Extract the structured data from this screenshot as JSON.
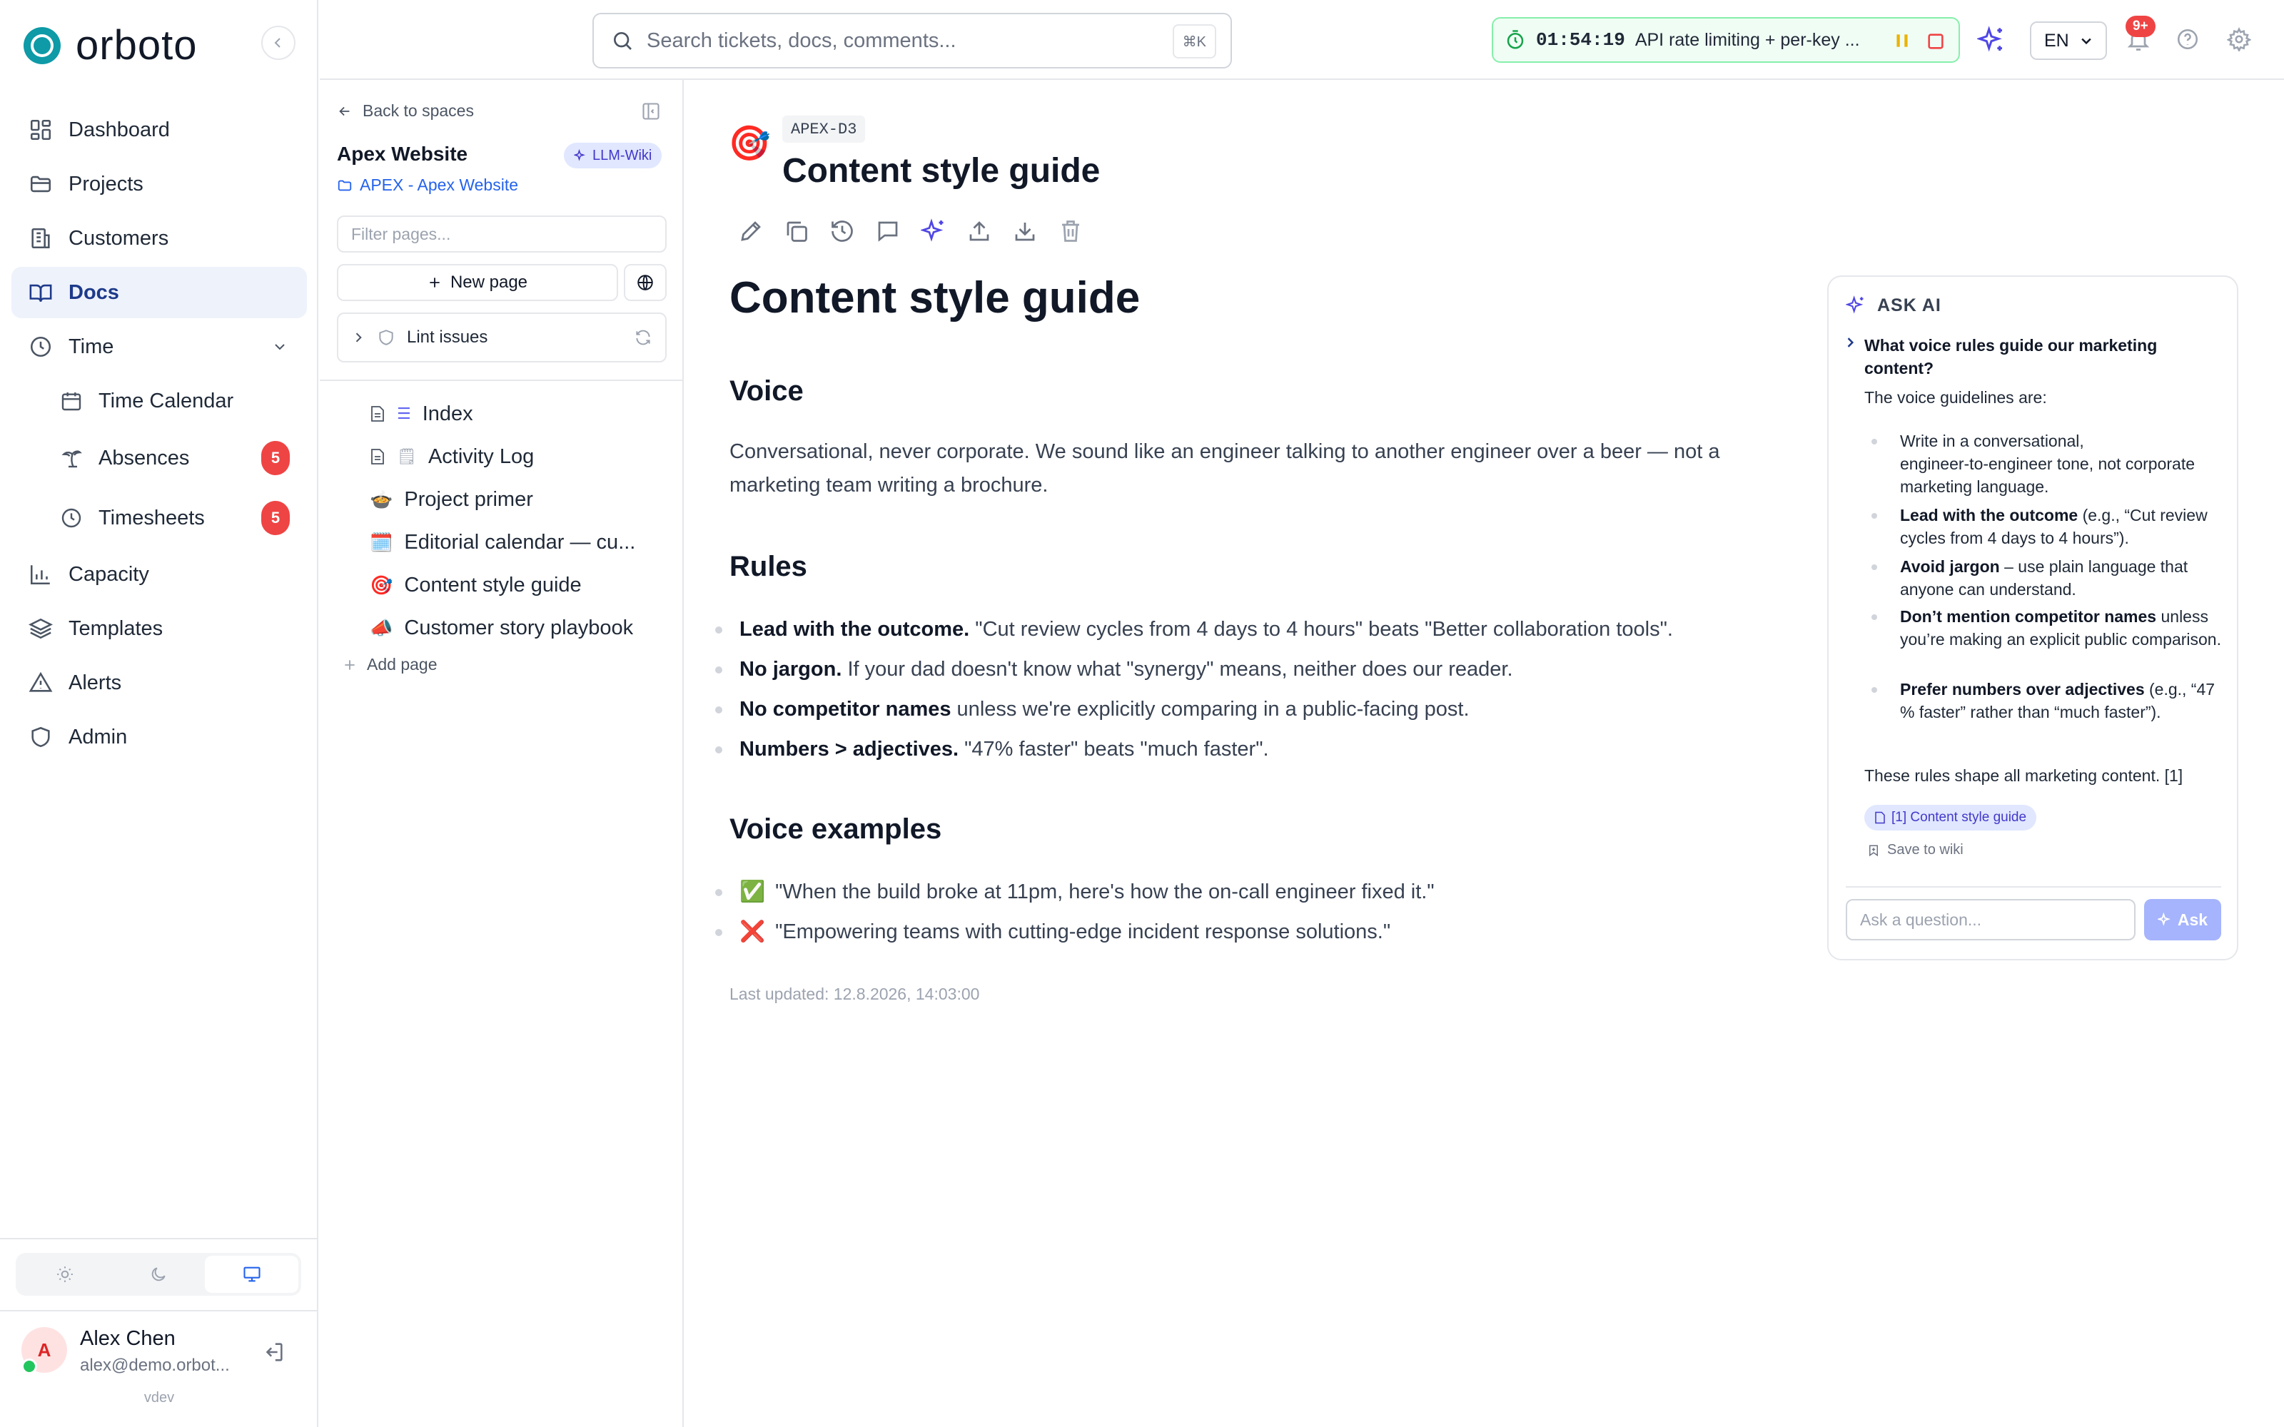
{
  "brand": {
    "name": "orboto",
    "accent": "#0e9aa7"
  },
  "nav": {
    "items": [
      {
        "label": "Dashboard",
        "icon": "dashboard-icon"
      },
      {
        "label": "Projects",
        "icon": "folder-icon"
      },
      {
        "label": "Customers",
        "icon": "building-icon"
      },
      {
        "label": "Docs",
        "icon": "book-icon"
      },
      {
        "label": "Time",
        "icon": "clock-icon"
      },
      {
        "label": "Capacity",
        "icon": "bar-chart-icon"
      },
      {
        "label": "Templates",
        "icon": "layers-icon"
      },
      {
        "label": "Alerts",
        "icon": "alert-icon"
      },
      {
        "label": "Admin",
        "icon": "shield-icon"
      }
    ],
    "time_sub": [
      {
        "label": "Time Calendar",
        "icon": "calendar-icon",
        "badge": ""
      },
      {
        "label": "Absences",
        "icon": "palm-tree-icon",
        "badge": "5"
      },
      {
        "label": "Timesheets",
        "icon": "clock-icon",
        "badge": "5"
      }
    ],
    "user": {
      "initial": "A",
      "name": "Alex Chen",
      "email": "alex@demo.orbot...",
      "version": "vdev"
    }
  },
  "tree": {
    "back_label": "Back to spaces",
    "space_name": "Apex Website",
    "space_badge": "LLM-Wiki",
    "project_link": "APEX - Apex Website",
    "filter_placeholder": "Filter pages...",
    "new_page_label": "New page",
    "lint_label": "Lint issues",
    "pages": [
      {
        "label": "Index",
        "emoji": "☰"
      },
      {
        "label": "Activity Log",
        "emoji": "🗒"
      },
      {
        "label": "Project primer",
        "emoji": "🍲"
      },
      {
        "label": "Editorial calendar — cu...",
        "emoji": "🗓️"
      },
      {
        "label": "Content style guide",
        "emoji": "🎯"
      },
      {
        "label": "Customer story playbook",
        "emoji": "📣"
      }
    ],
    "add_page_label": "Add page"
  },
  "topbar": {
    "search_placeholder": "Search tickets, docs, comments...",
    "search_shortcut": "⌘K",
    "timer_time": "01:54:19",
    "timer_task": "API rate limiting + per-key ...",
    "language": "EN",
    "notif_badge": "9+"
  },
  "doc": {
    "key": "APEX-D3",
    "emoji": "🎯",
    "title": "Content style guide",
    "heading": "Content style guide",
    "voice_h": "Voice",
    "voice_p": "Conversational, never corporate. We sound like an engineer talking to another engineer over a beer — not a marketing team writing a brochure.",
    "rules_h": "Rules",
    "rules": [
      {
        "bold": "Lead with the outcome.",
        "text": " \"Cut review cycles from 4 days to 4 hours\" beats \"Better collaboration tools\"."
      },
      {
        "bold": "No jargon.",
        "text": " If your dad doesn't know what \"synergy\" means, neither does our reader."
      },
      {
        "bold": "No competitor names",
        "text": " unless we're explicitly comparing in a public-facing post."
      },
      {
        "bold": "Numbers > adjectives.",
        "text": " \"47% faster\" beats \"much faster\"."
      }
    ],
    "examples_h": "Voice examples",
    "examples": [
      {
        "emoji": "✅",
        "text": "\"When the build broke at 11pm, here's how the on-call engineer fixed it.\""
      },
      {
        "emoji": "❌",
        "text": "\"Empowering teams with cutting-edge incident response solutions.\""
      }
    ],
    "updated": "Last updated: 12.8.2026, 14:03:00"
  },
  "ai": {
    "header": "ASK AI",
    "question": "What voice rules guide our marketing content?",
    "intro": "The voice guidelines are:",
    "items": [
      {
        "bold": "",
        "text": "Write in a conversational, engineer‑to‑engineer tone, not corporate marketing language."
      },
      {
        "bold": "Lead with the outcome",
        "text": " (e.g., “Cut review cycles from 4 days to 4 hours”)."
      },
      {
        "bold": "Avoid jargon",
        "text": " – use plain language that anyone can understand."
      },
      {
        "bold": "Don’t mention competitor names",
        "text": " unless you’re making an explicit public comparison."
      },
      {
        "bold": "Prefer numbers over adjectives",
        "text": " (e.g., “47 % faster” rather than “much faster”)."
      }
    ],
    "outro": "These rules shape all marketing content. [1]",
    "citation": "[1] Content style guide",
    "save_label": "Save to wiki",
    "input_placeholder": "Ask a question...",
    "ask_label": "Ask"
  }
}
